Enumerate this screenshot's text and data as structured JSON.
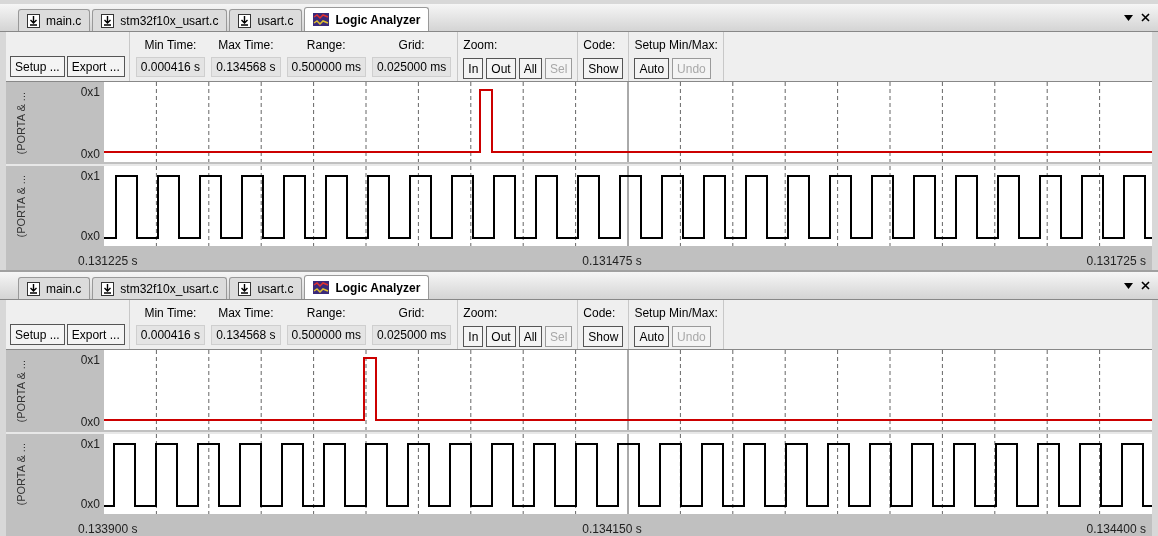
{
  "panels": [
    {
      "tabs": [
        {
          "label": "main.c",
          "kind": "file",
          "selected": false
        },
        {
          "label": "stm32f10x_usart.c",
          "kind": "file",
          "selected": false
        },
        {
          "label": "usart.c",
          "kind": "file",
          "selected": false
        },
        {
          "label": "Logic Analyzer",
          "kind": "analyzer",
          "selected": true
        }
      ],
      "actions": [
        "Setup ...",
        "Export ..."
      ],
      "fields": [
        {
          "label": "Min Time:",
          "value": "0.000416 s"
        },
        {
          "label": "Max Time:",
          "value": "0.134568 s"
        },
        {
          "label": "Range:",
          "value": "0.500000 ms"
        },
        {
          "label": "Grid:",
          "value": "0.025000 ms"
        }
      ],
      "button_groups": [
        {
          "label": "Zoom:",
          "buttons": [
            {
              "label": "In",
              "disabled": false
            },
            {
              "label": "Out",
              "disabled": false
            },
            {
              "label": "All",
              "disabled": false
            },
            {
              "label": "Sel",
              "disabled": true
            }
          ]
        },
        {
          "label": "Code:",
          "buttons": [
            {
              "label": "Show",
              "disabled": false
            }
          ]
        },
        {
          "label": "Setup Min/Max:",
          "buttons": [
            {
              "label": "Auto",
              "disabled": false
            },
            {
              "label": "Undo",
              "disabled": true
            }
          ]
        }
      ],
      "signals": [
        {
          "name": "(PORTA & ...",
          "high": "0x1",
          "low": "0x0",
          "kind": "pulse",
          "color": "#cc0000"
        },
        {
          "name": "(PORTA & ...",
          "high": "0x1",
          "low": "0x0",
          "kind": "clock",
          "color": "#000000"
        }
      ],
      "axis": [
        "0.131225 s",
        "0.131475 s",
        "0.131725 s"
      ]
    },
    {
      "tabs": [
        {
          "label": "main.c",
          "kind": "file",
          "selected": false
        },
        {
          "label": "stm32f10x_usart.c",
          "kind": "file",
          "selected": false
        },
        {
          "label": "usart.c",
          "kind": "file",
          "selected": false
        },
        {
          "label": "Logic Analyzer",
          "kind": "analyzer",
          "selected": true
        }
      ],
      "actions": [
        "Setup ...",
        "Export ..."
      ],
      "fields": [
        {
          "label": "Min Time:",
          "value": "0.000416 s"
        },
        {
          "label": "Max Time:",
          "value": "0.134568 s"
        },
        {
          "label": "Range:",
          "value": "0.500000 ms"
        },
        {
          "label": "Grid:",
          "value": "0.025000 ms"
        }
      ],
      "button_groups": [
        {
          "label": "Zoom:",
          "buttons": [
            {
              "label": "In",
              "disabled": false
            },
            {
              "label": "Out",
              "disabled": false
            },
            {
              "label": "All",
              "disabled": false
            },
            {
              "label": "Sel",
              "disabled": true
            }
          ]
        },
        {
          "label": "Code:",
          "buttons": [
            {
              "label": "Show",
              "disabled": false
            }
          ]
        },
        {
          "label": "Setup Min/Max:",
          "buttons": [
            {
              "label": "Auto",
              "disabled": false
            },
            {
              "label": "Undo",
              "disabled": true
            }
          ]
        }
      ],
      "signals": [
        {
          "name": "(PORTA & ...",
          "high": "0x1",
          "low": "0x0",
          "kind": "pulse",
          "color": "#cc0000"
        },
        {
          "name": "(PORTA & ...",
          "high": "0x1",
          "low": "0x0",
          "kind": "clock",
          "color": "#000000"
        }
      ],
      "axis": [
        "0.133900 s",
        "0.134150 s",
        "0.134400 s"
      ]
    }
  ]
}
